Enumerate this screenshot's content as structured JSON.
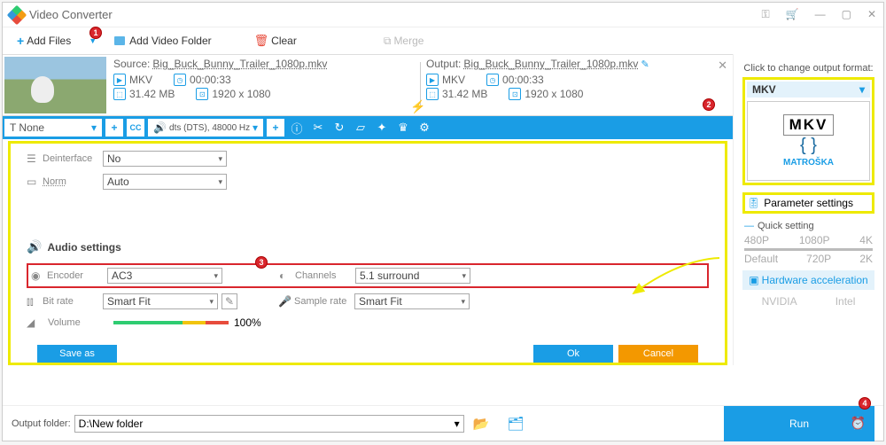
{
  "title": "Video Converter",
  "toolbar": {
    "add_files": "Add Files",
    "add_folder": "Add Video Folder",
    "clear": "Clear",
    "merge": "Merge"
  },
  "file": {
    "source_label": "Source:",
    "source_name": "Big_Buck_Bunny_Trailer_1080p.mkv",
    "output_label": "Output:",
    "output_name": "Big_Buck_Bunny_Trailer_1080p.mkv",
    "src": {
      "format": "MKV",
      "duration": "00:00:33",
      "size": "31.42 MB",
      "res": "1920 x 1080"
    },
    "out": {
      "format": "MKV",
      "duration": "00:00:33",
      "size": "31.42 MB",
      "res": "1920 x 1080"
    }
  },
  "editbar": {
    "subtitle": "None",
    "audio_track": "dts (DTS), 48000 Hz"
  },
  "params": {
    "deinterlace": {
      "label": "Deinterface",
      "value": "No"
    },
    "norm": {
      "label": "Norm",
      "value": "Auto"
    },
    "audio_section": "Audio settings",
    "encoder": {
      "label": "Encoder",
      "value": "AC3"
    },
    "channels": {
      "label": "Channels",
      "value": "5.1 surround"
    },
    "bitrate": {
      "label": "Bit rate",
      "value": "Smart Fit"
    },
    "samplerate": {
      "label": "Sample rate",
      "value": "Smart Fit"
    },
    "volume": {
      "label": "Volume",
      "value": "100%"
    },
    "buttons": {
      "saveas": "Save as",
      "ok": "Ok",
      "cancel": "Cancel"
    }
  },
  "right": {
    "header": "Click to change output format:",
    "format": "MKV",
    "format_brand": "MATROŠKA",
    "param_settings": "Parameter settings",
    "quick": "Quick setting",
    "presets": [
      "480P",
      "1080P",
      "4K",
      "Default",
      "720P",
      "2K"
    ],
    "hw": "Hardware acceleration",
    "nvidia": "NVIDIA",
    "intel": "Intel"
  },
  "bottom": {
    "label": "Output folder:",
    "path": "D:\\New folder",
    "run": "Run"
  },
  "badges": [
    "1",
    "2",
    "3",
    "4"
  ]
}
